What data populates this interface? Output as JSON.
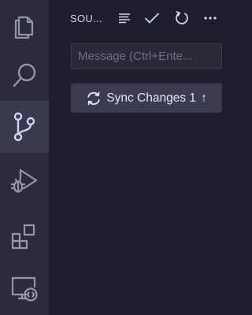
{
  "colors": {
    "activity_bar_bg": "#2b2b3c",
    "active_item_bg": "#3a3a4e",
    "panel_bg": "#1e1e2e",
    "icon": "#9396ac",
    "active_icon": "#cdd6f4",
    "button_bg": "#3b3b52"
  },
  "activity_bar": {
    "items": [
      {
        "icon": "files-icon",
        "active": false
      },
      {
        "icon": "search-icon",
        "active": false
      },
      {
        "icon": "source-control-icon",
        "active": true
      },
      {
        "icon": "run-debug-icon",
        "active": false
      },
      {
        "icon": "extensions-icon",
        "active": false
      },
      {
        "icon": "remote-explorer-icon",
        "active": false
      }
    ]
  },
  "panel": {
    "title": "SOU...",
    "header_actions": [
      {
        "icon": "view-as-tree-icon"
      },
      {
        "icon": "commit-check-icon"
      },
      {
        "icon": "refresh-icon"
      },
      {
        "icon": "more-actions-icon"
      }
    ],
    "message_input": {
      "placeholder": "Message (Ctrl+Ente...",
      "value": ""
    },
    "sync_button": {
      "label": "Sync Changes 1",
      "arrow": "↑",
      "icon": "sync-icon"
    }
  }
}
